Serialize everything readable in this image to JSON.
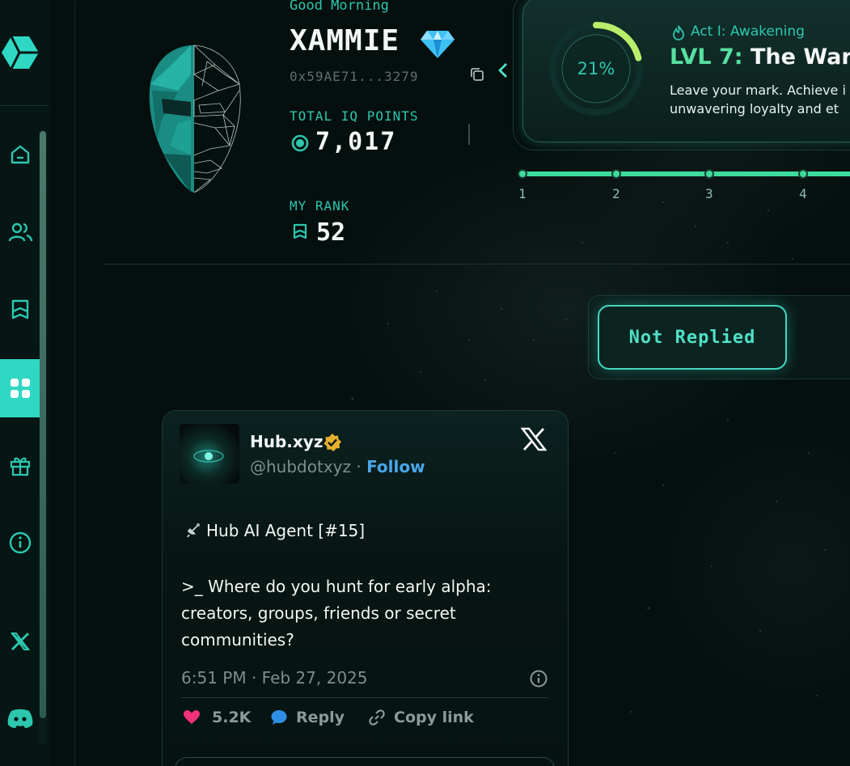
{
  "profile": {
    "greeting": "Good Morning",
    "username": "XAMMIE",
    "wallet": "0x59AE71...3279",
    "iq_label": "TOTAL IQ POINTS",
    "iq_value": "7,017",
    "rank_label": "MY RANK",
    "rank_value": "52"
  },
  "level": {
    "progress_text": "21%",
    "progress_fraction": 0.21,
    "act": "Act I: Awakening",
    "level_prefix": "LVL 7:",
    "level_name": "The Ward",
    "desc_line1": "Leave your mark. Achieve i",
    "desc_line2": "unwavering loyalty and et"
  },
  "track": {
    "nodes": [
      "1",
      "2",
      "3",
      "4"
    ]
  },
  "filters": {
    "active": "Not Replied"
  },
  "tweet": {
    "name": "Hub.xyz",
    "handle": "@hubdotxyz",
    "separator": " · ",
    "follow": "Follow",
    "line1": "Hub AI Agent [#15]",
    "body": ">_ Where do you hunt for early alpha: creators, groups, friends or secret communities?",
    "time": "6:51 PM · Feb 27, 2025",
    "likes": "5.2K",
    "reply": "Reply",
    "copy": "Copy link"
  },
  "colors": {
    "accent": "#2cc7ae",
    "level_green": "#57e0a0",
    "active_nav": "#2fd8c3",
    "link_blue": "#4aa6e8",
    "like_pink": "#f0317a"
  }
}
